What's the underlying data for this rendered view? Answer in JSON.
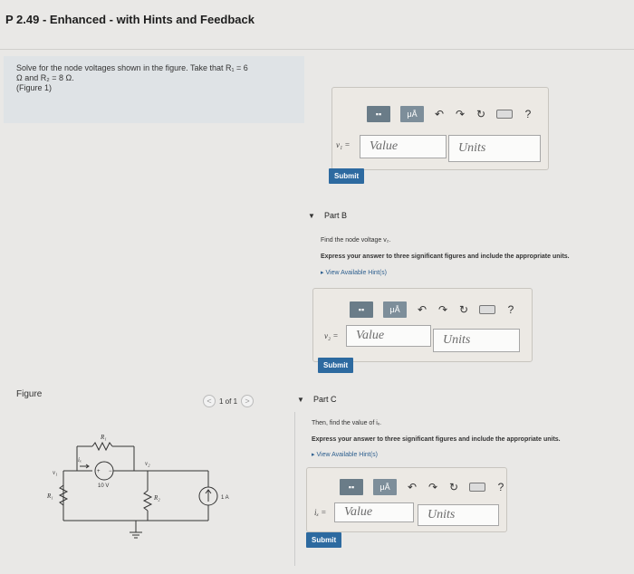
{
  "header": {
    "title": "P 2.49 - Enhanced - with Hints and Feedback"
  },
  "problem": {
    "line1": "Solve for the node voltages shown in the figure. Take that R₁ = 6",
    "line2": "Ω and R₂ = 8 Ω.",
    "figure_link": "(Figure 1)"
  },
  "figure": {
    "label": "Figure",
    "pager": "1 of 1",
    "prev": "<",
    "next": ">",
    "circuit": {
      "r1_top": "R₁",
      "ix": "iₓ",
      "v1": "v₁",
      "v2": "v₂",
      "source_v": "10 V",
      "r1_left": "R₁",
      "r2": "R₂",
      "source_i": "1 A",
      "plus": "+",
      "minus": "−"
    }
  },
  "toolbar": {
    "templates": "▪▪",
    "units": "μÅ",
    "undo": "↶",
    "redo": "↷",
    "reset": "↻",
    "keyboard": "",
    "help": "?"
  },
  "partA": {
    "var": "v₁ =",
    "value_placeholder": "Value",
    "units_placeholder": "Units",
    "submit": "Submit"
  },
  "partB": {
    "label": "Part B",
    "question": "Find the node voltage v₂.",
    "instruction": "Express your answer to three significant figures and include the appropriate units.",
    "hints": "View Available Hint(s)",
    "var": "v₂ =",
    "value_placeholder": "Value",
    "units_placeholder": "Units",
    "submit": "Submit"
  },
  "partC": {
    "label": "Part C",
    "question": "Then, find the value of iₓ.",
    "instruction": "Express your answer to three significant figures and include the appropriate units.",
    "hints": "View Available Hint(s)",
    "var": "iₓ =",
    "value_placeholder": "Value",
    "units_placeholder": "Units",
    "submit": "Submit"
  }
}
